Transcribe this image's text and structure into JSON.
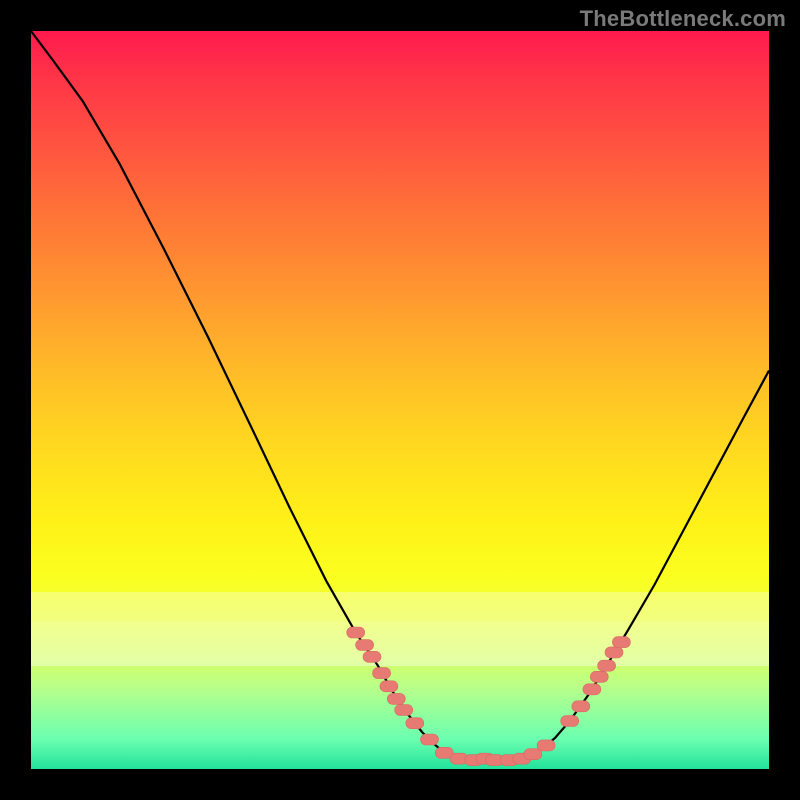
{
  "watermark": "TheBottleneck.com",
  "colors": {
    "background": "#000000",
    "curve_stroke": "#000000",
    "marker_fill": "#e77b74",
    "marker_stroke": "#d66a63"
  },
  "whitewash_bands": [
    {
      "top_frac": 0.76,
      "height_frac": 0.04,
      "opacity": 0.32
    },
    {
      "top_frac": 0.8,
      "height_frac": 0.06,
      "opacity": 0.4
    }
  ],
  "chart_data": {
    "type": "line",
    "title": "",
    "xlabel": "",
    "ylabel": "",
    "xlim": [
      0,
      1
    ],
    "ylim": [
      0,
      1
    ],
    "grid": false,
    "curve_left": [
      {
        "x": 0.0,
        "y": 1.0
      },
      {
        "x": 0.03,
        "y": 0.96
      },
      {
        "x": 0.07,
        "y": 0.905
      },
      {
        "x": 0.12,
        "y": 0.82
      },
      {
        "x": 0.18,
        "y": 0.705
      },
      {
        "x": 0.24,
        "y": 0.585
      },
      {
        "x": 0.3,
        "y": 0.46
      },
      {
        "x": 0.35,
        "y": 0.355
      },
      {
        "x": 0.4,
        "y": 0.255
      },
      {
        "x": 0.44,
        "y": 0.185
      },
      {
        "x": 0.47,
        "y": 0.14
      },
      {
        "x": 0.49,
        "y": 0.105
      },
      {
        "x": 0.51,
        "y": 0.075
      },
      {
        "x": 0.53,
        "y": 0.05
      },
      {
        "x": 0.545,
        "y": 0.035
      },
      {
        "x": 0.56,
        "y": 0.022
      },
      {
        "x": 0.575,
        "y": 0.015
      },
      {
        "x": 0.59,
        "y": 0.012
      }
    ],
    "curve_right": [
      {
        "x": 0.66,
        "y": 0.012
      },
      {
        "x": 0.675,
        "y": 0.016
      },
      {
        "x": 0.69,
        "y": 0.025
      },
      {
        "x": 0.71,
        "y": 0.042
      },
      {
        "x": 0.73,
        "y": 0.065
      },
      {
        "x": 0.755,
        "y": 0.1
      },
      {
        "x": 0.78,
        "y": 0.14
      },
      {
        "x": 0.81,
        "y": 0.19
      },
      {
        "x": 0.845,
        "y": 0.25
      },
      {
        "x": 0.885,
        "y": 0.325
      },
      {
        "x": 0.925,
        "y": 0.4
      },
      {
        "x": 0.965,
        "y": 0.475
      },
      {
        "x": 1.0,
        "y": 0.54
      }
    ],
    "markers": [
      {
        "x": 0.44,
        "y": 0.185
      },
      {
        "x": 0.452,
        "y": 0.168
      },
      {
        "x": 0.462,
        "y": 0.152
      },
      {
        "x": 0.475,
        "y": 0.13
      },
      {
        "x": 0.485,
        "y": 0.112
      },
      {
        "x": 0.495,
        "y": 0.095
      },
      {
        "x": 0.505,
        "y": 0.08
      },
      {
        "x": 0.52,
        "y": 0.062
      },
      {
        "x": 0.54,
        "y": 0.04
      },
      {
        "x": 0.56,
        "y": 0.022
      },
      {
        "x": 0.58,
        "y": 0.014
      },
      {
        "x": 0.6,
        "y": 0.012
      },
      {
        "x": 0.615,
        "y": 0.014
      },
      {
        "x": 0.628,
        "y": 0.012
      },
      {
        "x": 0.648,
        "y": 0.012
      },
      {
        "x": 0.665,
        "y": 0.014
      },
      {
        "x": 0.68,
        "y": 0.02
      },
      {
        "x": 0.698,
        "y": 0.032
      },
      {
        "x": 0.73,
        "y": 0.065
      },
      {
        "x": 0.745,
        "y": 0.085
      },
      {
        "x": 0.76,
        "y": 0.108
      },
      {
        "x": 0.77,
        "y": 0.125
      },
      {
        "x": 0.78,
        "y": 0.14
      },
      {
        "x": 0.79,
        "y": 0.158
      },
      {
        "x": 0.8,
        "y": 0.172
      }
    ]
  }
}
